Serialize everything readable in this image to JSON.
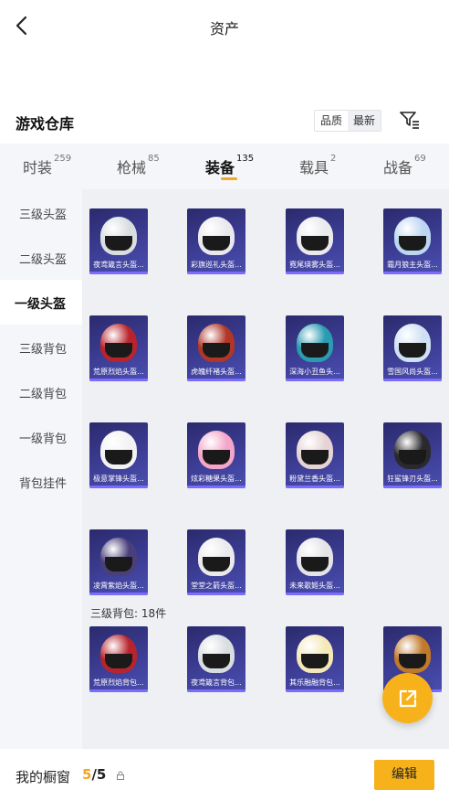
{
  "header": {
    "title": "资产"
  },
  "warehouse": {
    "title": "游戏仓库",
    "sort_options": [
      "品质",
      "最新"
    ],
    "active_sort": "最新"
  },
  "tabs": [
    {
      "label": "时装",
      "count": "259"
    },
    {
      "label": "枪械",
      "count": "85"
    },
    {
      "label": "装备",
      "count": "135",
      "active": true
    },
    {
      "label": "载具",
      "count": "2"
    },
    {
      "label": "战备",
      "count": "69"
    }
  ],
  "sidebar": {
    "items": [
      {
        "label": "三级头盔"
      },
      {
        "label": "二级头盔"
      },
      {
        "label": "一级头盔",
        "active": true
      },
      {
        "label": "三级背包"
      },
      {
        "label": "二级背包"
      },
      {
        "label": "一级背包"
      },
      {
        "label": "背包挂件"
      }
    ]
  },
  "items": [
    {
      "name": "夜鸢箴言头盔...",
      "color": "#d8dde0"
    },
    {
      "name": "彩旗巡礼头盔...",
      "color": "#e8e8ee"
    },
    {
      "name": "霓尾瑛雾头盔...",
      "color": "#e9e9ee"
    },
    {
      "name": "霜月狼主头盔...",
      "color": "#bcd6f2"
    },
    {
      "name": "荒原烈焰头盔...",
      "color": "#b8242c"
    },
    {
      "name": "虎魄纤褚头盔...",
      "color": "#b03628"
    },
    {
      "name": "深海小丑鱼头...",
      "color": "#2a9bb0"
    },
    {
      "name": "雪国风尚头盔...",
      "color": "#cfe0f4"
    },
    {
      "name": "极意掌锋头盔...",
      "color": "#f2f2f4"
    },
    {
      "name": "炫彩糖果头盔...",
      "color": "#f3a6c8"
    },
    {
      "name": "粉黛兰香头盔...",
      "color": "#e6d4d4"
    },
    {
      "name": "狂鲨锋刃头盔...",
      "color": "#2a2a2e"
    },
    {
      "name": "凌霄紫焰头盔...",
      "color": "#4a3f7a"
    },
    {
      "name": "堂堂之箭头盔...",
      "color": "#eaeaec"
    },
    {
      "name": "未来歌姬头盔...",
      "color": "#e4e4e8"
    }
  ],
  "section": {
    "label": "三级背包: 18件"
  },
  "backpacks": [
    {
      "name": "荒原烈焰背包...",
      "color": "#b8242c"
    },
    {
      "name": "夜鸢箴言背包...",
      "color": "#d8dde0"
    },
    {
      "name": "其乐融融背包...",
      "color": "#f4e8b8"
    },
    {
      "name": "",
      "color": "#c07a2a"
    }
  ],
  "bottom": {
    "window_label": "我的橱窗",
    "window_current": "5",
    "window_total": "/5",
    "edit_label": "编辑"
  }
}
